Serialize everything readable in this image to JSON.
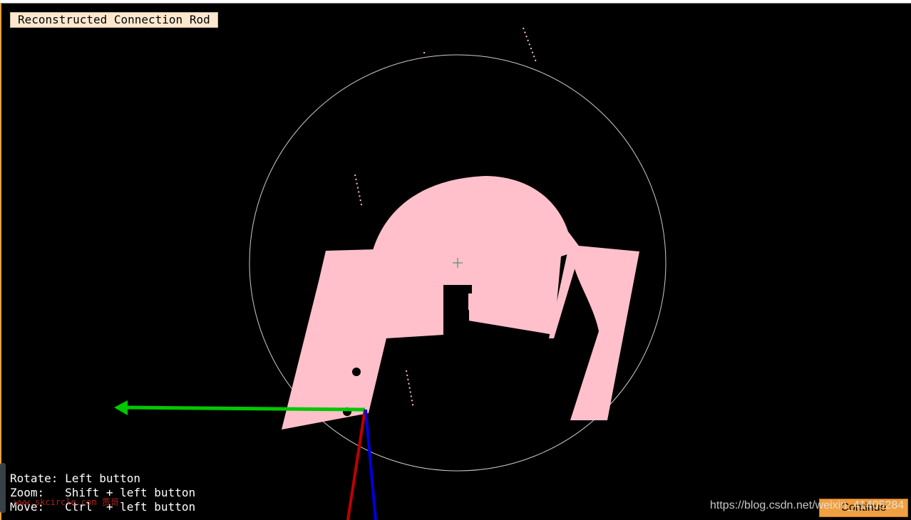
{
  "window": {
    "title": "Reconstructed Connection Rod"
  },
  "help": {
    "rotate": "Rotate: Left button",
    "zoom": "Zoom:   Shift + left button",
    "move": "Move:   Ctrl  + left button"
  },
  "buttons": {
    "continue_label": "Continue"
  },
  "watermarks": {
    "left": "www.skcircle.com 贾哥",
    "right": "https://blog.csdn.net/weixin_41405284"
  },
  "colors": {
    "object": "#ffc0cb",
    "axis_x": "#00c800",
    "axis_y": "#c00000",
    "axis_z": "#0000e0",
    "sphere": "#cccccc",
    "background": "#000000",
    "button": "#f0a040"
  },
  "icons": {
    "crosshair": "crosshair-icon",
    "rotation_sphere": "trackball-sphere-icon"
  }
}
